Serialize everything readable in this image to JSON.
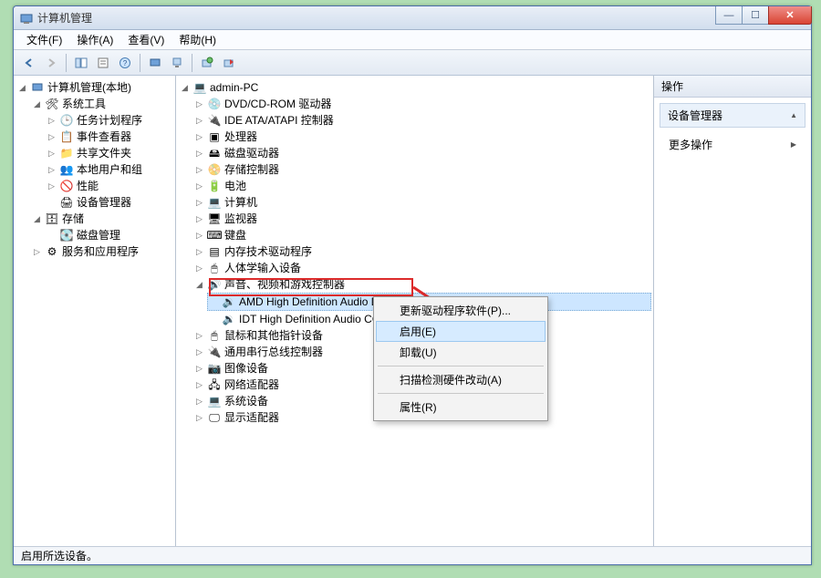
{
  "window": {
    "title": "计算机管理"
  },
  "menu": {
    "file": "文件(F)",
    "action": "操作(A)",
    "view": "查看(V)",
    "help": "帮助(H)"
  },
  "left_tree": {
    "root": "计算机管理(本地)",
    "sys_tools": "系统工具",
    "task_sched": "任务计划程序",
    "event_viewer": "事件查看器",
    "shared_folders": "共享文件夹",
    "local_users": "本地用户和组",
    "perf": "性能",
    "dev_mgr": "设备管理器",
    "storage": "存储",
    "disk_mgmt": "磁盘管理",
    "svc_apps": "服务和应用程序"
  },
  "dev_tree": {
    "root": "admin-PC",
    "dvd": "DVD/CD-ROM 驱动器",
    "ide": "IDE ATA/ATAPI 控制器",
    "cpu": "处理器",
    "disk_drives": "磁盘驱动器",
    "storage_ctrl": "存储控制器",
    "battery": "电池",
    "computer": "计算机",
    "monitor": "监视器",
    "keyboard": "键盘",
    "memtech": "内存技术驱动程序",
    "hid": "人体学输入设备",
    "sound": "声音、视频和游戏控制器",
    "amd_audio": "AMD High Definition Audio Device",
    "idt_audio": "IDT High Definition Audio CO",
    "mouse": "鼠标和其他指针设备",
    "usb": "通用串行总线控制器",
    "imaging": "图像设备",
    "net": "网络适配器",
    "sysdev": "系统设备",
    "display": "显示适配器"
  },
  "context_menu": {
    "update_driver": "更新驱动程序软件(P)...",
    "enable": "启用(E)",
    "uninstall": "卸载(U)",
    "scan_hw": "扫描检测硬件改动(A)",
    "properties": "属性(R)"
  },
  "right_pane": {
    "title": "操作",
    "group": "设备管理器",
    "more": "更多操作"
  },
  "status": "启用所选设备。"
}
